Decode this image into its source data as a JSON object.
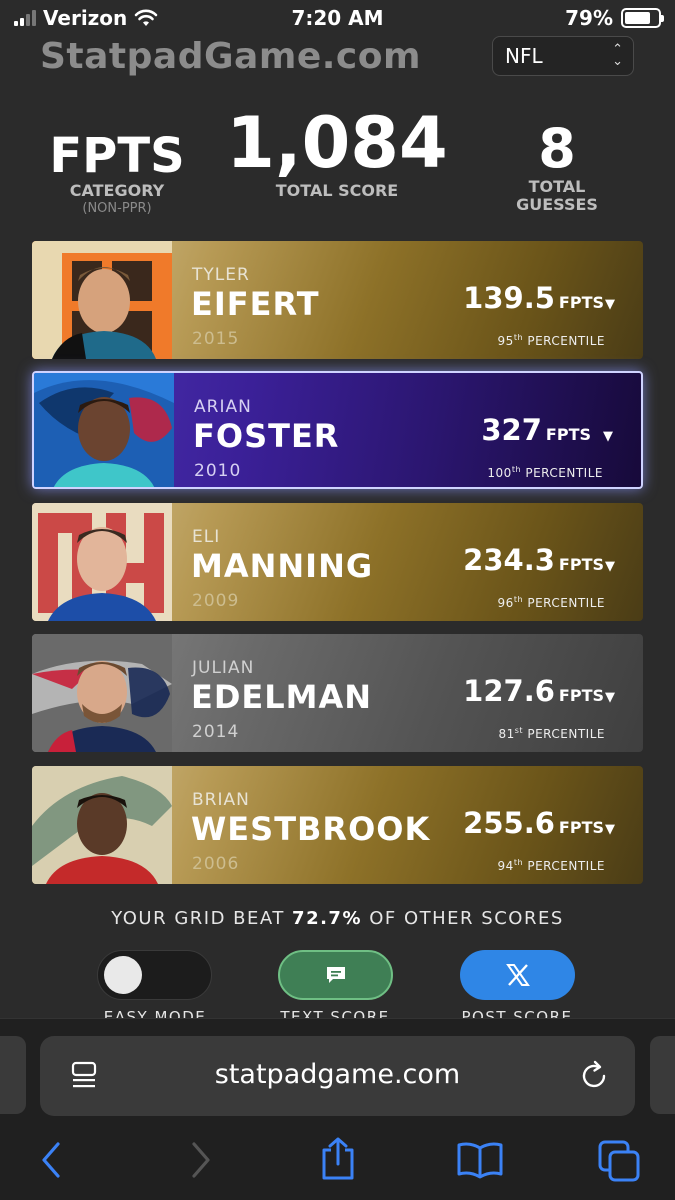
{
  "status_bar": {
    "carrier": "Verizon",
    "time": "7:20 AM",
    "battery": "79%",
    "battery_level": 0.79
  },
  "header": {
    "site_title": "StatpadGame.com",
    "league_select": "NFL"
  },
  "stats": {
    "category_value": "FPTS",
    "category_label": "CATEGORY",
    "category_sub": "(NON-PPR)",
    "score_value": "1,084",
    "score_label": "TOTAL SCORE",
    "guesses_value": "8",
    "guesses_label_1": "TOTAL",
    "guesses_label_2": "GUESSES"
  },
  "players": [
    {
      "first": "TYLER",
      "last": "EIFERT",
      "year": "2015",
      "points": "139.5",
      "unit": "FPTS",
      "pct_num": "95",
      "pct_suffix": "th",
      "pct_word": "PERCENTILE",
      "team": "bengals"
    },
    {
      "first": "ARIAN",
      "last": "FOSTER",
      "year": "2010",
      "points": "327",
      "unit": "FPTS",
      "pct_num": "100",
      "pct_suffix": "th",
      "pct_word": "PERCENTILE",
      "team": "texans"
    },
    {
      "first": "ELI",
      "last": "MANNING",
      "year": "2009",
      "points": "234.3",
      "unit": "FPTS",
      "pct_num": "96",
      "pct_suffix": "th",
      "pct_word": "PERCENTILE",
      "team": "giants"
    },
    {
      "first": "JULIAN",
      "last": "EDELMAN",
      "year": "2014",
      "points": "127.6",
      "unit": "FPTS",
      "pct_num": "81",
      "pct_suffix": "st",
      "pct_word": "PERCENTILE",
      "team": "patriots"
    },
    {
      "first": "BRIAN",
      "last": "WESTBROOK",
      "year": "2006",
      "points": "255.6",
      "unit": "FPTS",
      "pct_num": "94",
      "pct_suffix": "th",
      "pct_word": "PERCENTILE",
      "team": "eagles"
    }
  ],
  "result": {
    "prefix": "YOUR GRID BEAT",
    "percent": "72.7%",
    "suffix": "OF OTHER SCORES"
  },
  "buttons": {
    "easy_mode": "EASY MODE",
    "text_score": "TEXT SCORE",
    "post_score": "POST SCORE"
  },
  "browser": {
    "url": "statpadgame.com"
  },
  "icons": {
    "cellular": "signal-icon",
    "wifi": "wifi-icon",
    "battery": "battery-icon",
    "reader": "reader-icon",
    "reload": "reload-icon",
    "back": "back-icon",
    "forward": "forward-icon",
    "share": "share-icon",
    "bookmarks": "bookmarks-icon",
    "tabs": "tabs-icon",
    "message": "message-icon",
    "x": "x-logo-icon"
  }
}
